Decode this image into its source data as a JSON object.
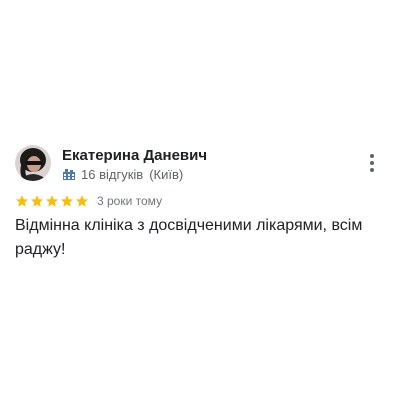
{
  "review": {
    "reviewer_name": "Екатерина Даневич",
    "reviews_count": "16 відгуків",
    "location": "(Київ)",
    "rating": 5,
    "rating_max": 5,
    "time_ago": "3 роки тому",
    "text": "Відмінна клініка з досвідченими лікарями, всім раджу!"
  },
  "icons": {
    "local_guide": "local-guide-badge-icon",
    "menu": "more-vertical-icon",
    "star": "star-icon"
  },
  "colors": {
    "star": "#fbbc04",
    "name": "#202124",
    "meta": "#5f6368",
    "time": "#70757a",
    "badge": "#4a7ab5"
  }
}
